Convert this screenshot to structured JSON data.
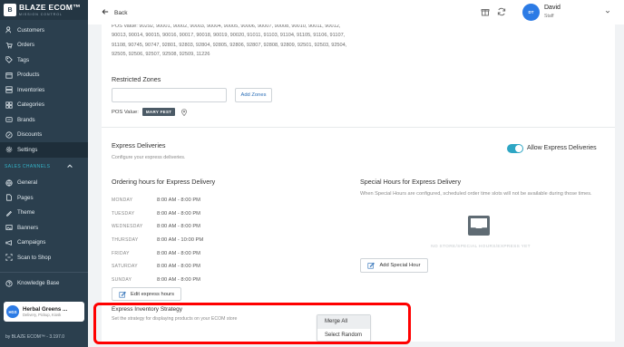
{
  "sidebar": {
    "brand_title": "BLAZE ECOM",
    "brand_tm": "™",
    "brand_subtitle": "MISSION CONTROL",
    "items": [
      {
        "label": "Customers",
        "icon": "users-icon"
      },
      {
        "label": "Orders",
        "icon": "cart-icon"
      },
      {
        "label": "Tags",
        "icon": "tag-icon"
      },
      {
        "label": "Products",
        "icon": "box-icon"
      },
      {
        "label": "Inventories",
        "icon": "inventory-icon"
      },
      {
        "label": "Categories",
        "icon": "categories-icon"
      },
      {
        "label": "Brands",
        "icon": "brands-icon"
      },
      {
        "label": "Discounts",
        "icon": "discount-icon"
      },
      {
        "label": "Settings",
        "icon": "gear-icon",
        "active": true
      }
    ],
    "sales_channels_label": "SALES CHANNELS",
    "channels": [
      {
        "label": "General",
        "icon": "globe-icon"
      },
      {
        "label": "Pages",
        "icon": "pages-icon"
      },
      {
        "label": "Theme",
        "icon": "theme-icon"
      },
      {
        "label": "Banners",
        "icon": "banner-icon"
      },
      {
        "label": "Campaigns",
        "icon": "campaign-icon"
      },
      {
        "label": "Scan to Shop",
        "icon": "scan-icon"
      }
    ],
    "knowledge_base": "Knowledge Base",
    "store": {
      "avatar": "HGS",
      "name": "Herbal Greens ...",
      "sub": "Delivery, Pickup, Kiosk"
    },
    "footer": "by BLAZE ECOM™ - 3.197.0"
  },
  "topbar": {
    "back_label": "Back",
    "user": {
      "initials": "DT",
      "name": "David",
      "role": "Staff"
    }
  },
  "restricted": {
    "pos_values_text": "POS Value: 90292, 90001, 90002, 90003, 90004, 90005, 90006, 90007, 90008, 90010, 90011, 90012, 90013, 90014, 90015, 90016, 90017, 90018, 90019, 90020, 91011, 91103, 91104, 91105, 91106, 91107, 91108, 90745, 90747, 92801, 92803, 92804, 92805, 92806, 92807, 92808, 92809, 92501, 92503, 92504, 92505, 92506, 92507, 92508, 92509, 11226",
    "title": "Restricted Zones",
    "input_value": "",
    "add_zones_label": "Add Zones",
    "pos_value_label": "POS Value:",
    "pos_tag": "MARY FEST"
  },
  "express": {
    "title": "Express Deliveries",
    "subtitle": "Configure your express deliveries.",
    "toggle_on": true,
    "toggle_label": "Allow Express Deliveries",
    "hours_title": "Ordering hours for Express Delivery",
    "schedule": [
      {
        "day": "MONDAY",
        "hours": "8:00 AM - 8:00 PM"
      },
      {
        "day": "TUESDAY",
        "hours": "8:00 AM - 8:00 PM"
      },
      {
        "day": "WEDNESDAY",
        "hours": "8:00 AM - 8:00 PM"
      },
      {
        "day": "THURSDAY",
        "hours": "8:00 AM - 10:00 PM"
      },
      {
        "day": "FRIDAY",
        "hours": "8:00 AM - 8:00 PM"
      },
      {
        "day": "SATURDAY",
        "hours": "8:00 AM - 8:00 PM"
      },
      {
        "day": "SUNDAY",
        "hours": "8:00 AM - 8:00 PM"
      }
    ],
    "edit_hours_label": "Edit express hours",
    "special_title": "Special Hours for Express Delivery",
    "special_info": "When Special Hours are configured, scheduled order time slots will not be available during those times.",
    "no_store_label": "NO STORE/SPECIAL HOURS/EXPRESS YET",
    "add_special_label": "Add Special Hour"
  },
  "strategy": {
    "title": "Express Inventory Strategy",
    "subtitle": "Set the strategy for displaying products on your ECOM store",
    "options": [
      "Merge All",
      "Select Random"
    ],
    "selected": "Merge All"
  },
  "colors": {
    "sidebar": "#2b3f4e",
    "accent": "#2ea6c4",
    "highlight": "#ff0000",
    "avatar": "#2c7be5"
  }
}
